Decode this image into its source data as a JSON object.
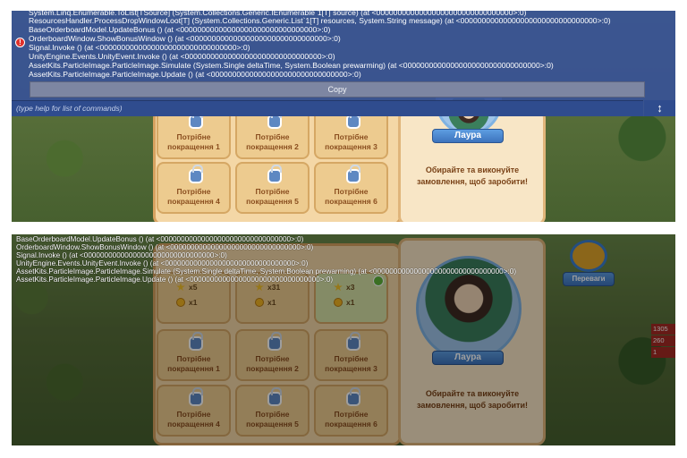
{
  "console": {
    "lines": [
      "System.Linq.Enumerable.ToList[TSource] (System.Collections.Generic.IEnumerable`1[T] source) (at <00000000000000000000000000000000>:0)",
      "ResourcesHandler.ProcessDropWindowLoot[T] (System.Collections.Generic.List`1[T] resources, System.String message) (at <00000000000000000000000000000000>:0)",
      "BaseOrderboardModel.UpdateBonus () (at <00000000000000000000000000000000>:0)",
      "OrderboardWindow.ShowBonusWindow () (at <00000000000000000000000000000000>:0)",
      "Signal.Invoke () (at <00000000000000000000000000000000>:0)",
      "UnityEngine.Events.UnityEvent.Invoke () (at <00000000000000000000000000000000>:0)",
      "AssetKits.ParticleImage.ParticleImage.Simulate (System.Single deltaTime, System.Boolean prewarming) (at <00000000000000000000000000000000>:0)",
      "AssetKits.ParticleImage.ParticleImage.Update () (at <00000000000000000000000000000000>:0)"
    ],
    "copy_label": "Copy",
    "command_placeholder": "(type help for list of commands)",
    "resize_glyph": "↕",
    "warn_glyph": "!"
  },
  "overlay_log": [
    "BaseOrderboardModel.UpdateBonus () (at <00000000000000000000000000000000>:0)",
    "OrderboardWindow.ShowBonusWindow () (at <00000000000000000000000000000000>:0)",
    "Signal.Invoke () (at <00000000000000000000000000000000>:0)",
    "UnityEngine.Events.UnityEvent.Invoke () (at <00000000000000000000000000000000>:0)",
    "AssetKits.ParticleImage.ParticleImage.Simulate (System.Single deltaTime, System.Boolean prewarming) (at <00000000000000000000000000000000>:0)",
    "AssetKits.ParticleImage.ParticleImage.Update () (at <00000000000000000000000000000000>:0)"
  ],
  "slots": [
    {
      "line1": "Потрібне",
      "line2": "покращення 1"
    },
    {
      "line1": "Потрібне",
      "line2": "покращення 2"
    },
    {
      "line1": "Потрібне",
      "line2": "покращення 3"
    },
    {
      "line1": "Потрібне",
      "line2": "покращення 4"
    },
    {
      "line1": "Потрібне",
      "line2": "покращення 5"
    },
    {
      "line1": "Потрібне",
      "line2": "покращення 6"
    }
  ],
  "rewards": [
    {
      "stars": "x5",
      "coins": "x1"
    },
    {
      "stars": "x31",
      "coins": "x1"
    },
    {
      "stars": "x3",
      "coins": "x1"
    }
  ],
  "character_name": "Лаура",
  "hint": {
    "line1": "Обирайте та виконуйте",
    "line2": "замовлення, щоб заробити!"
  },
  "perks_label": "Переваги",
  "stats": [
    "1305",
    "260",
    "1"
  ],
  "colors": {
    "console_bg": "#3852964d",
    "panel": "#f4d7a6",
    "banner": "#3d73bd"
  }
}
